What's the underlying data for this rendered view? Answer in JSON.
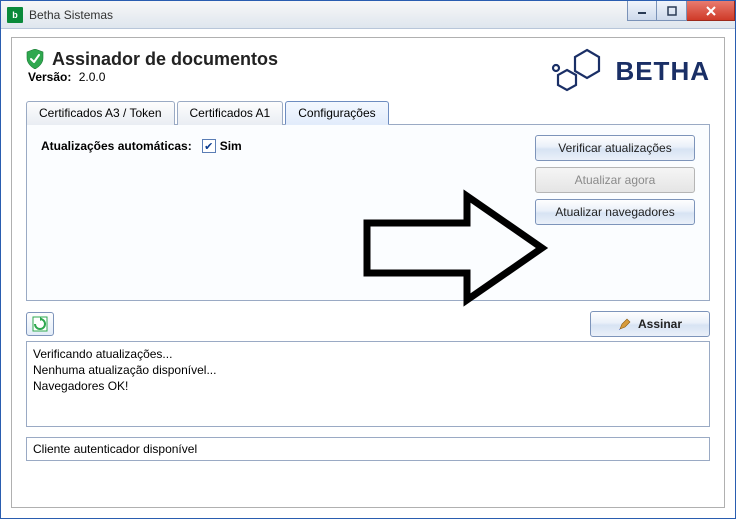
{
  "window": {
    "title": "Betha Sistemas"
  },
  "header": {
    "app_title": "Assinador de documentos",
    "version_label": "Versão:",
    "version_value": "2.0.0",
    "brand": "BETHA"
  },
  "tabs": {
    "cert_a3": "Certificados A3 / Token",
    "cert_a1": "Certificados A1",
    "config": "Configurações"
  },
  "config": {
    "auto_updates_label": "Atualizações automáticas:",
    "auto_updates_value": "Sim",
    "btn_check": "Verificar atualizações",
    "btn_update_now": "Atualizar agora",
    "btn_update_browsers": "Atualizar navegadores"
  },
  "actions": {
    "sign": "Assinar"
  },
  "log": {
    "line1": "Verificando atualizações...",
    "line2": "Nenhuma atualização disponível...",
    "line3": "Navegadores OK!"
  },
  "status": {
    "text": "Cliente autenticador disponível"
  }
}
